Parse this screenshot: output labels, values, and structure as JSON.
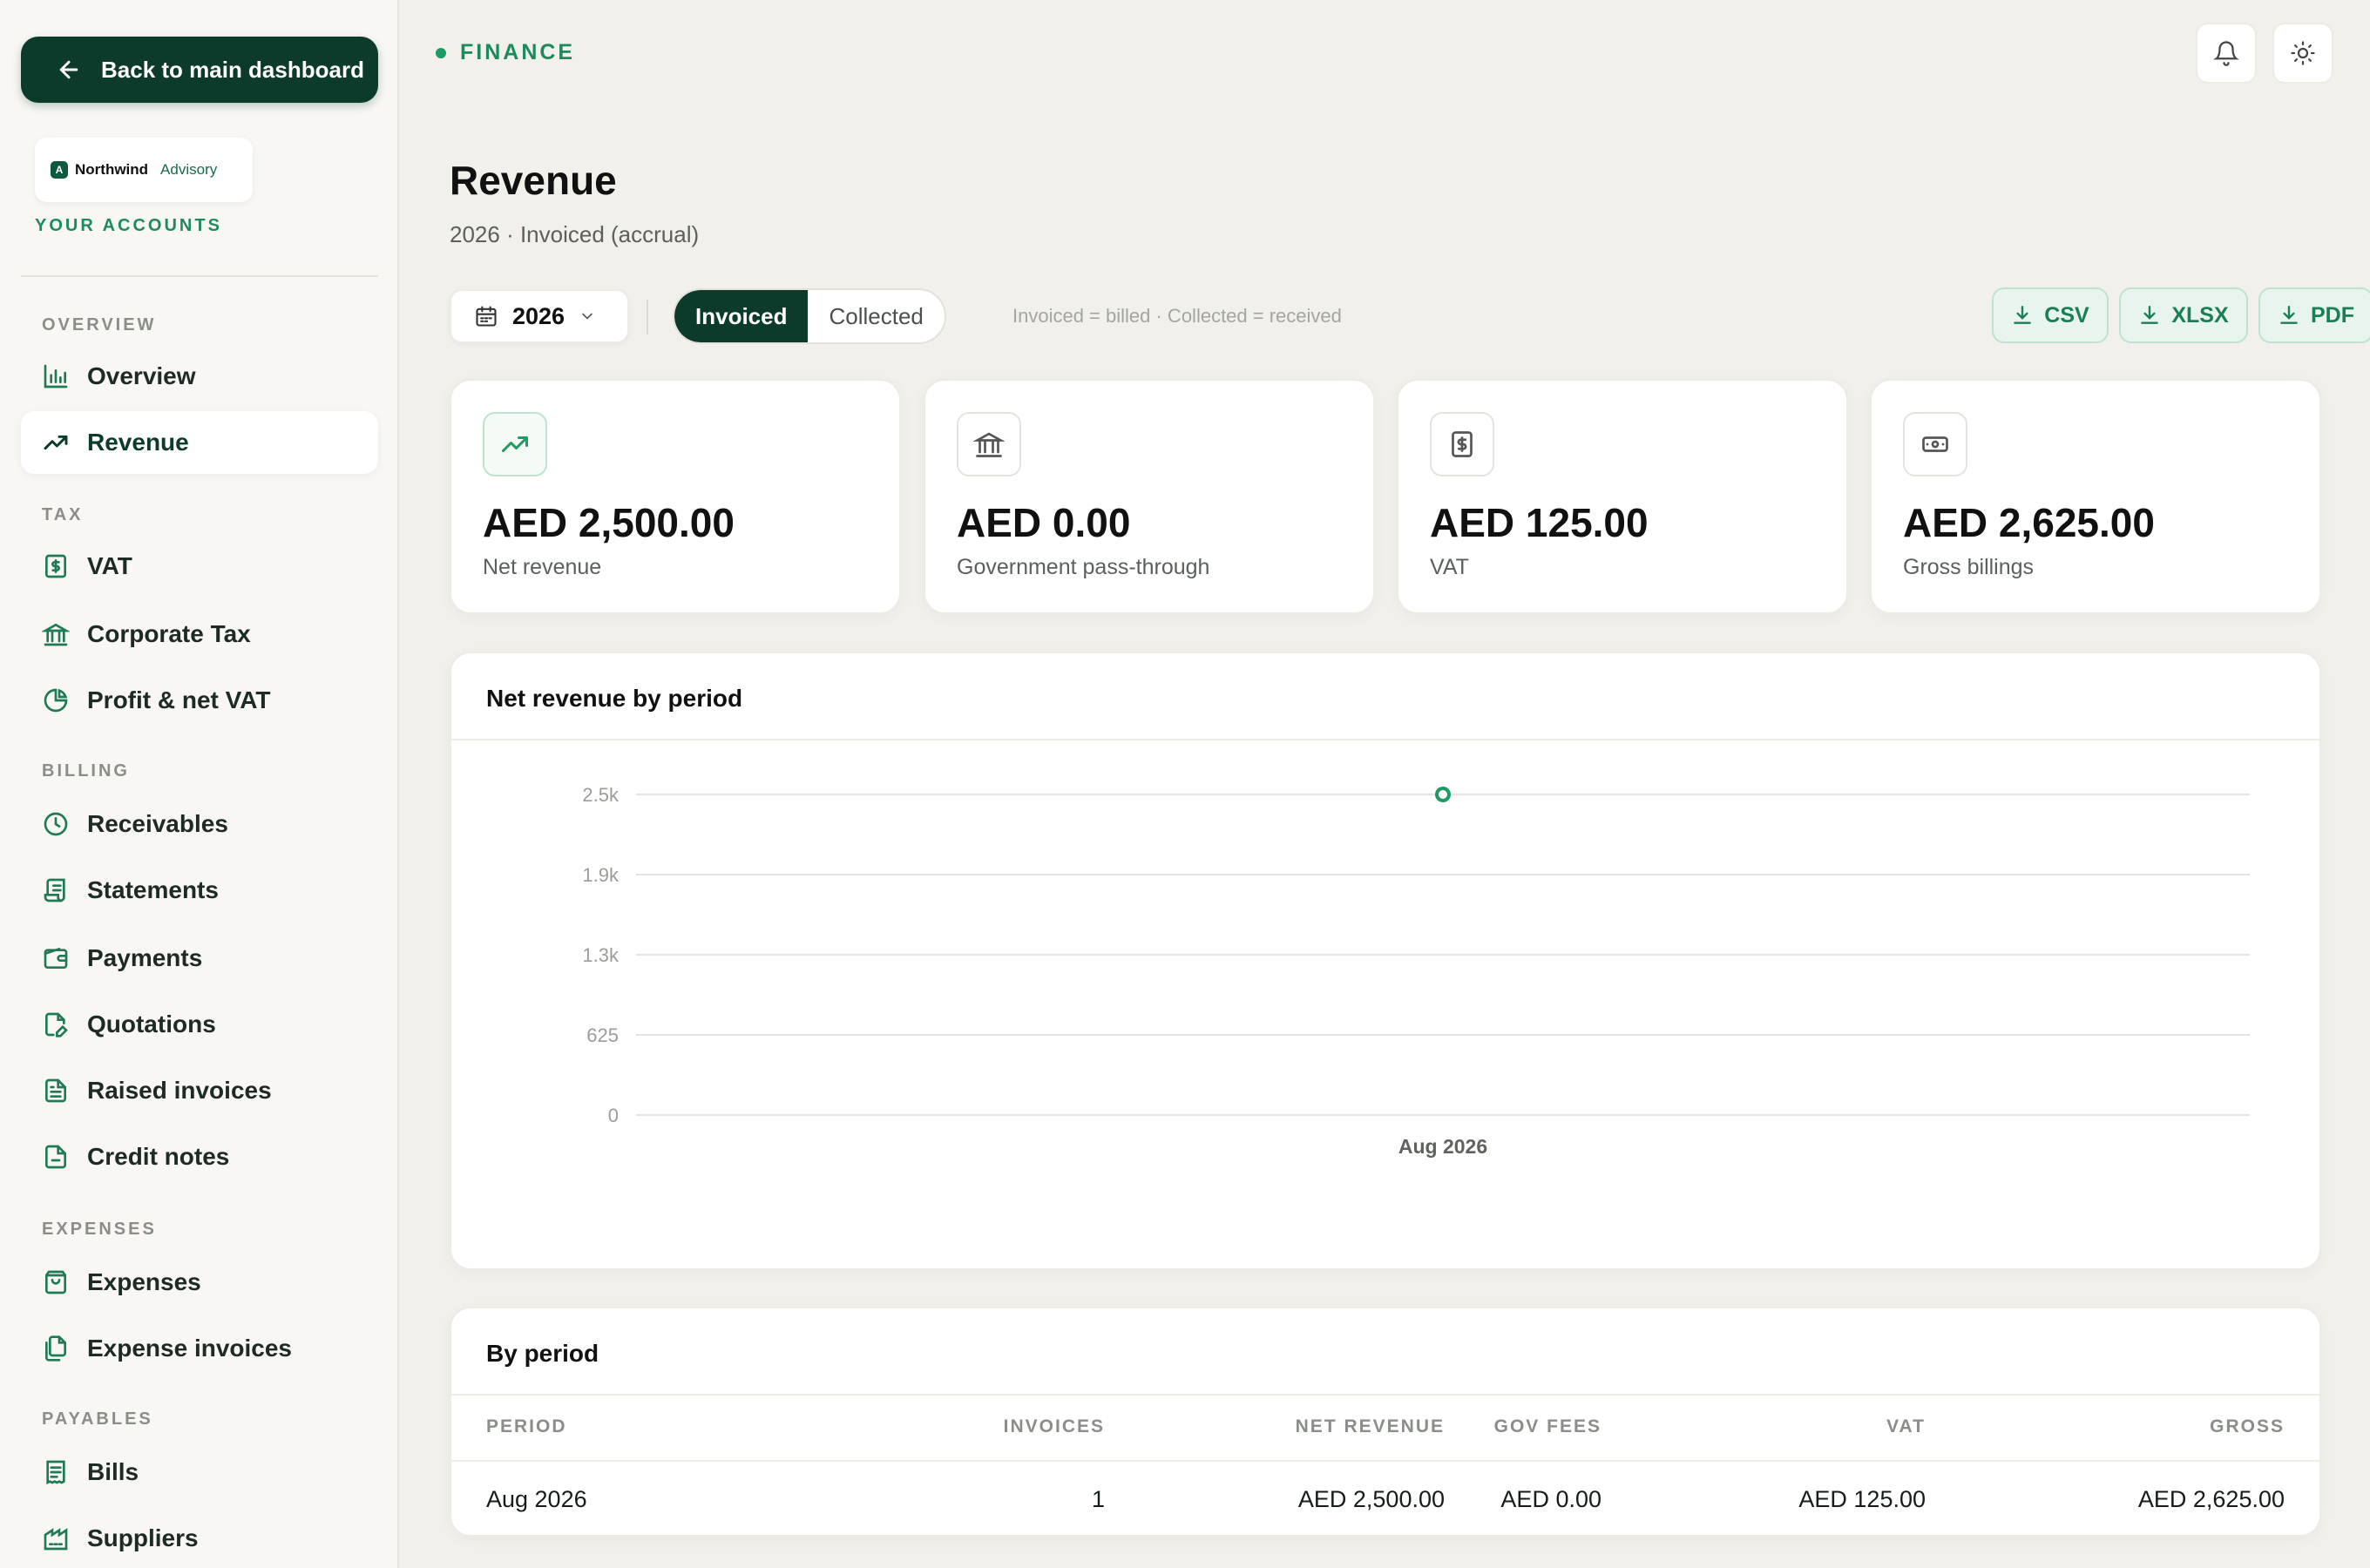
{
  "sidebar": {
    "back_label": "Back to main dashboard",
    "logo": {
      "name": "Northwind",
      "sub": "Advisory",
      "mark": "A"
    },
    "accounts_label": "YOUR ACCOUNTS",
    "sections": [
      {
        "label": "OVERVIEW"
      },
      {
        "label": "TAX"
      },
      {
        "label": "BILLING"
      },
      {
        "label": "EXPENSES"
      },
      {
        "label": "PAYABLES"
      }
    ],
    "items": [
      {
        "label": "Overview",
        "icon": "bar-chart-icon"
      },
      {
        "label": "Revenue",
        "icon": "trending-up-icon",
        "active": true
      },
      {
        "label": "VAT",
        "icon": "receipt-icon"
      },
      {
        "label": "Corporate Tax",
        "icon": "bank-icon"
      },
      {
        "label": "Profit & net VAT",
        "icon": "pie-chart-icon"
      },
      {
        "label": "Receivables",
        "icon": "clock-icon"
      },
      {
        "label": "Statements",
        "icon": "scroll-icon"
      },
      {
        "label": "Payments",
        "icon": "wallet-icon"
      },
      {
        "label": "Quotations",
        "icon": "file-edit-icon"
      },
      {
        "label": "Raised invoices",
        "icon": "file-text-icon"
      },
      {
        "label": "Credit notes",
        "icon": "file-icon"
      },
      {
        "label": "Expenses",
        "icon": "shopping-bag-icon"
      },
      {
        "label": "Expense invoices",
        "icon": "files-icon"
      },
      {
        "label": "Bills",
        "icon": "bill-icon"
      },
      {
        "label": "Suppliers",
        "icon": "suppliers-icon"
      }
    ]
  },
  "header": {
    "breadcrumb": "FINANCE",
    "title": "Revenue",
    "subtitle": "2026 · Invoiced (accrual)"
  },
  "toolbar": {
    "year": "2026",
    "segments": [
      "Invoiced",
      "Collected"
    ],
    "active_segment": "Invoiced",
    "hint": "Invoiced = billed · Collected = received",
    "exports": [
      "CSV",
      "XLSX",
      "PDF"
    ]
  },
  "kpis": [
    {
      "value": "AED 2,500.00",
      "label": "Net revenue",
      "icon": "trending-up-icon"
    },
    {
      "value": "AED 0.00",
      "label": "Government pass-through",
      "icon": "bank-icon"
    },
    {
      "value": "AED 125.00",
      "label": "VAT",
      "icon": "receipt-icon"
    },
    {
      "value": "AED 2,625.00",
      "label": "Gross billings",
      "icon": "banknote-icon"
    }
  ],
  "chart_card": {
    "title": "Net revenue by period"
  },
  "chart_data": {
    "type": "line",
    "x": [
      "Aug 2026"
    ],
    "series": [
      {
        "values": [
          2500
        ]
      }
    ],
    "yticks": [
      "0",
      "625",
      "1.3k",
      "1.9k",
      "2.5k"
    ],
    "ytick_values": [
      0,
      625,
      1250,
      1875,
      2500
    ],
    "ylim": [
      0,
      2500
    ],
    "grid": true,
    "color": "#1e9a63"
  },
  "table": {
    "title": "By period",
    "columns": [
      "PERIOD",
      "INVOICES",
      "NET REVENUE",
      "GOV FEES",
      "VAT",
      "GROSS"
    ],
    "rows": [
      [
        "Aug 2026",
        "1",
        "AED 2,500.00",
        "AED 0.00",
        "AED 125.00",
        "AED 2,625.00"
      ]
    ]
  },
  "colors": {
    "accent": "#0d3b2b",
    "green": "#1e9a63",
    "background": "#f1f0ea"
  }
}
